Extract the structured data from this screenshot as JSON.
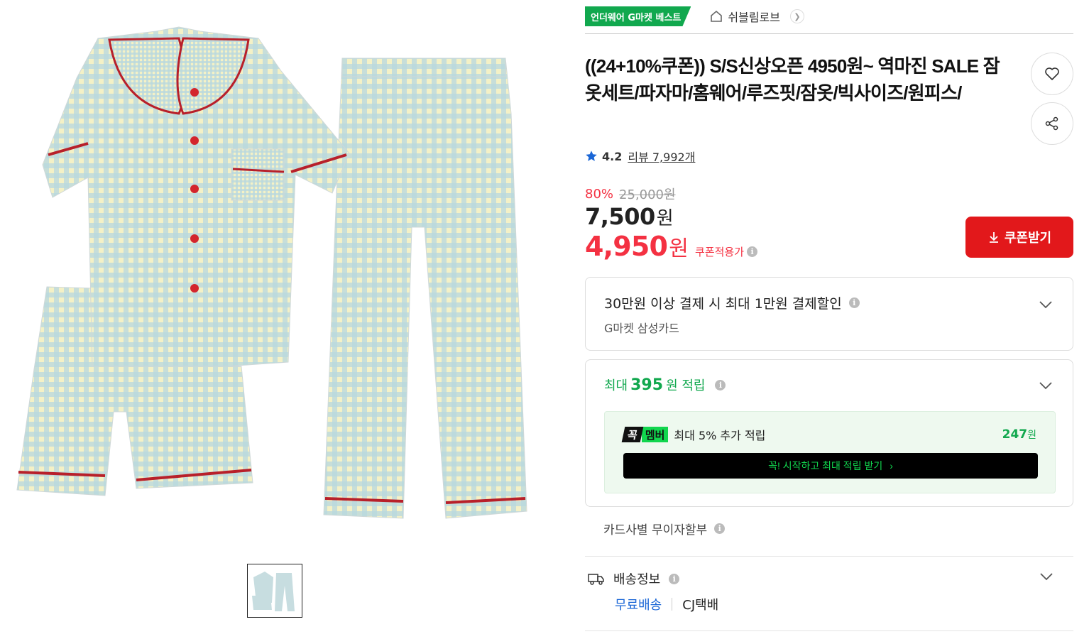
{
  "badge": {
    "label": "언더웨어 G마켓 베스트"
  },
  "shop": {
    "name": "쉬블림로브"
  },
  "product": {
    "title": "((24+10%쿠폰)) S/S신상오픈 4950원~ 역마진 SALE 잠옷세트/파자마/홈웨어/루즈핏/잠옷/빅사이즈/원피스/",
    "rating": "4.2",
    "review_label": "리뷰 7,992개"
  },
  "price": {
    "discount_pct": "80%",
    "original": "25,000원",
    "sale_value": "7,500",
    "sale_unit": "원",
    "coupon_value": "4,950",
    "coupon_unit": "원",
    "coupon_note": "쿠폰적용가"
  },
  "coupon_button": {
    "label": "쿠폰받기"
  },
  "card_discount": {
    "title": "30만원 이상 결제 시 최대 1만원 결제할인",
    "subtitle": "G마켓 삼성카드"
  },
  "points": {
    "prefix": "최대",
    "amount": "395",
    "suffix": "원 적립",
    "member": {
      "logo_a": "꼭",
      "logo_b": "멤버",
      "text": "최대 5% 추가 적립",
      "amount": "247",
      "unit": "원",
      "cta": "꼭! 시작하고 최대 적립 받기",
      "cta_arrow": "›"
    }
  },
  "installment": {
    "label": "카드사별 무이자할부"
  },
  "shipping": {
    "title": "배송정보",
    "free": "무료배송",
    "courier": "CJ택배"
  },
  "colors": {
    "accent_red": "#e2181b",
    "price_red": "#f43142",
    "brand_green": "#11a84e",
    "member_green": "#11d64e",
    "link_blue": "#1a66d6"
  },
  "icons": [
    "home-icon",
    "chevron-right-icon",
    "heart-icon",
    "share-icon",
    "star-icon",
    "download-icon",
    "info-icon",
    "chevron-down-icon",
    "truck-icon"
  ]
}
